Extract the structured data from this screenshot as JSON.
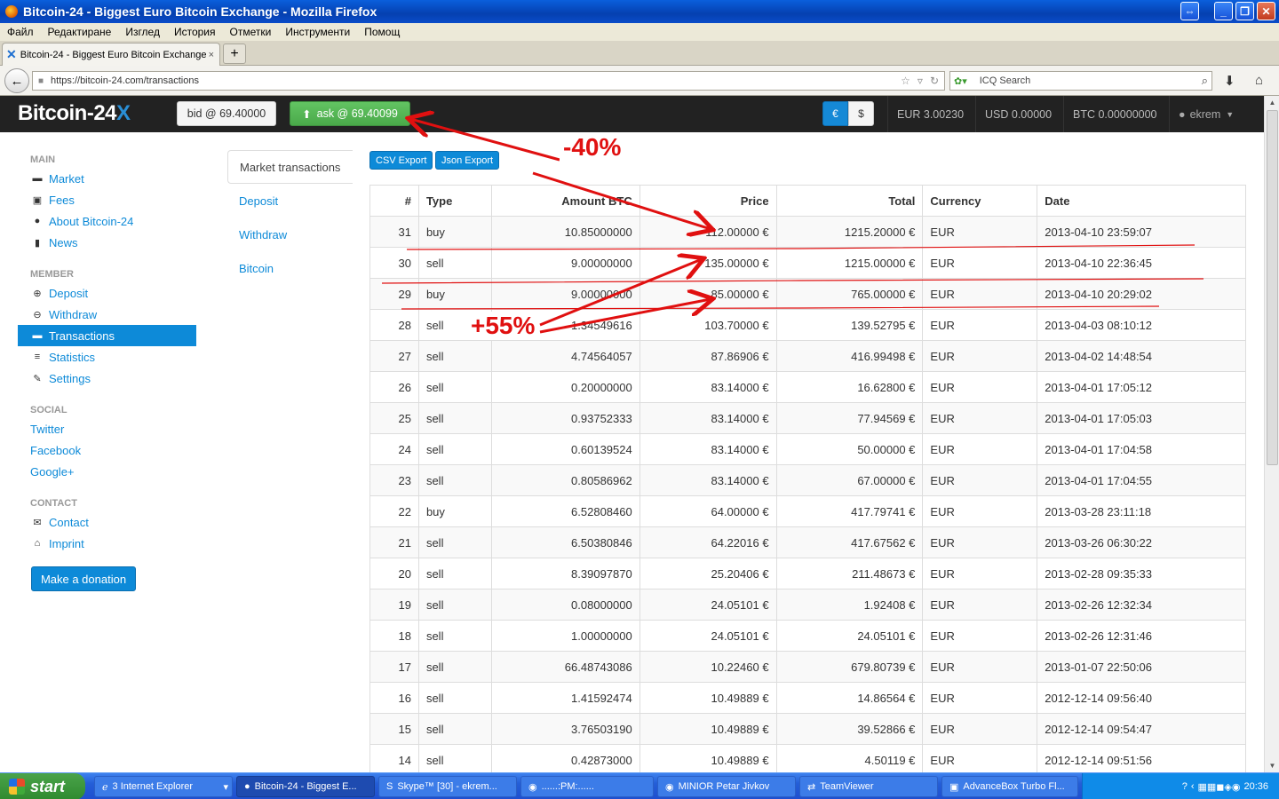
{
  "window": {
    "title": "Bitcoin-24 - Biggest Euro Bitcoin Exchange - Mozilla Firefox"
  },
  "menu": [
    "Файл",
    "Редактиране",
    "Изглед",
    "История",
    "Отметки",
    "Инструменти",
    "Помощ"
  ],
  "tab": {
    "title": "Bitcoin-24 - Biggest Euro Bitcoin Exchange"
  },
  "url": "https://bitcoin-24.com/transactions",
  "search": {
    "placeholder": "ICQ Search"
  },
  "site": {
    "logo_text": "Bitcoin-24",
    "logo_x": "X",
    "bid": "bid @ 69.40000",
    "ask": "ask @ 69.40099",
    "cur_eur": "€",
    "cur_usd": "$",
    "bal_eur": "EUR 3.00230",
    "bal_usd": "USD 0.00000",
    "bal_btc": "BTC 0.00000000",
    "user": "ekrem"
  },
  "sidebar": {
    "main_head": "MAIN",
    "market": "Market",
    "fees": "Fees",
    "about": "About Bitcoin-24",
    "news": "News",
    "member_head": "MEMBER",
    "deposit": "Deposit",
    "withdraw": "Withdraw",
    "transactions": "Transactions",
    "statistics": "Statistics",
    "settings": "Settings",
    "social_head": "SOCIAL",
    "twitter": "Twitter",
    "facebook": "Facebook",
    "google": "Google+",
    "contact_head": "CONTACT",
    "contact": "Contact",
    "imprint": "Imprint",
    "donate": "Make a donation"
  },
  "subnav": [
    "Market transactions",
    "Deposit",
    "Withdraw",
    "Bitcoin"
  ],
  "export": {
    "csv": "CSV Export",
    "json": "Json Export"
  },
  "table": {
    "headers": [
      "#",
      "Type",
      "Amount BTC",
      "Price",
      "Total",
      "Currency",
      "Date"
    ],
    "rows": [
      [
        "31",
        "buy",
        "10.85000000",
        "112.00000 €",
        "1215.20000 €",
        "EUR",
        "2013-04-10 23:59:07"
      ],
      [
        "30",
        "sell",
        "9.00000000",
        "135.00000 €",
        "1215.00000 €",
        "EUR",
        "2013-04-10 22:36:45"
      ],
      [
        "29",
        "buy",
        "9.00000000",
        "85.00000 €",
        "765.00000 €",
        "EUR",
        "2013-04-10 20:29:02"
      ],
      [
        "28",
        "sell",
        "1.34549616",
        "103.70000 €",
        "139.52795 €",
        "EUR",
        "2013-04-03 08:10:12"
      ],
      [
        "27",
        "sell",
        "4.74564057",
        "87.86906 €",
        "416.99498 €",
        "EUR",
        "2013-04-02 14:48:54"
      ],
      [
        "26",
        "sell",
        "0.20000000",
        "83.14000 €",
        "16.62800 €",
        "EUR",
        "2013-04-01 17:05:12"
      ],
      [
        "25",
        "sell",
        "0.93752333",
        "83.14000 €",
        "77.94569 €",
        "EUR",
        "2013-04-01 17:05:03"
      ],
      [
        "24",
        "sell",
        "0.60139524",
        "83.14000 €",
        "50.00000 €",
        "EUR",
        "2013-04-01 17:04:58"
      ],
      [
        "23",
        "sell",
        "0.80586962",
        "83.14000 €",
        "67.00000 €",
        "EUR",
        "2013-04-01 17:04:55"
      ],
      [
        "22",
        "buy",
        "6.52808460",
        "64.00000 €",
        "417.79741 €",
        "EUR",
        "2013-03-28 23:11:18"
      ],
      [
        "21",
        "sell",
        "6.50380846",
        "64.22016 €",
        "417.67562 €",
        "EUR",
        "2013-03-26 06:30:22"
      ],
      [
        "20",
        "sell",
        "8.39097870",
        "25.20406 €",
        "211.48673 €",
        "EUR",
        "2013-02-28 09:35:33"
      ],
      [
        "19",
        "sell",
        "0.08000000",
        "24.05101 €",
        "1.92408 €",
        "EUR",
        "2013-02-26 12:32:34"
      ],
      [
        "18",
        "sell",
        "1.00000000",
        "24.05101 €",
        "24.05101 €",
        "EUR",
        "2013-02-26 12:31:46"
      ],
      [
        "17",
        "sell",
        "66.48743086",
        "10.22460 €",
        "679.80739 €",
        "EUR",
        "2013-01-07 22:50:06"
      ],
      [
        "16",
        "sell",
        "1.41592474",
        "10.49889 €",
        "14.86564 €",
        "EUR",
        "2012-12-14 09:56:40"
      ],
      [
        "15",
        "sell",
        "3.76503190",
        "10.49889 €",
        "39.52866 €",
        "EUR",
        "2012-12-14 09:54:47"
      ],
      [
        "14",
        "sell",
        "0.42873000",
        "10.49889 €",
        "4.50119 €",
        "EUR",
        "2012-12-14 09:51:56"
      ]
    ]
  },
  "annotations": {
    "minus": "-40%",
    "plus": "+55%",
    "color": "#e01010"
  },
  "taskbar": {
    "start": "start",
    "items": [
      "3 Internet Explorer",
      "Bitcoin-24 - Biggest E...",
      "Skype™ [30] - ekrem...",
      "......:PM:......",
      "MINIOR Petar Jivkov",
      "TeamViewer",
      "AdvanceBox Turbo Fl..."
    ],
    "clock": "20:36"
  }
}
